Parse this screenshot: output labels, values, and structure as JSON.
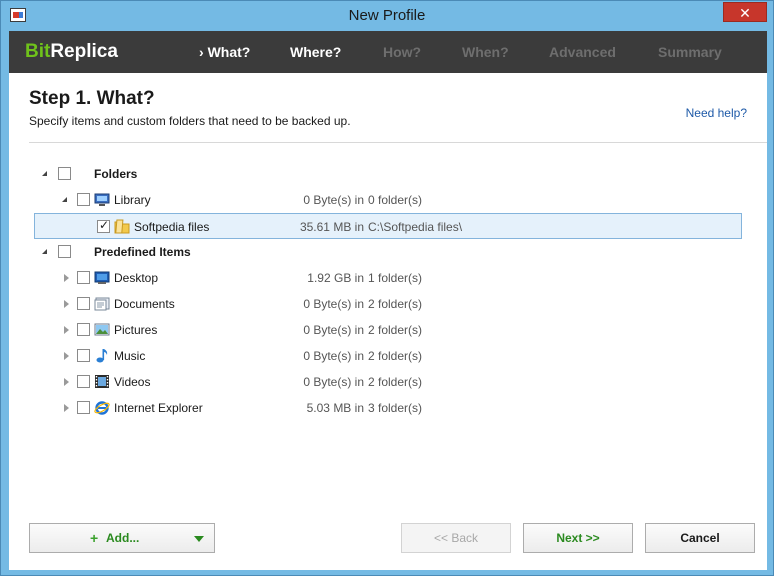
{
  "window": {
    "title": "New Profile",
    "close_glyph": "✕"
  },
  "brand": {
    "part1": "Bit",
    "part2": "Replica"
  },
  "steps": [
    {
      "label": "What?",
      "marker": "›",
      "state": "active"
    },
    {
      "label": "Where?",
      "state": "enabled"
    },
    {
      "label": "How?",
      "state": "disabled"
    },
    {
      "label": "When?",
      "state": "disabled"
    },
    {
      "label": "Advanced",
      "state": "disabled"
    },
    {
      "label": "Summary",
      "state": "disabled"
    }
  ],
  "page": {
    "title": "Step 1. What?",
    "subtitle": "Specify items and custom folders that need to be backed up.",
    "help": "Need help?"
  },
  "tree": {
    "folders": {
      "label": "Folders",
      "checked": false
    },
    "library": {
      "label": "Library",
      "size": "0 Byte(s) in",
      "detail": "0 folder(s)",
      "checked": false
    },
    "softpedia": {
      "label": "Softpedia files",
      "size": "35.61 MB in",
      "detail": "C:\\Softpedia files\\",
      "checked": true
    },
    "predefined": {
      "label": "Predefined Items",
      "checked": false
    },
    "items": [
      {
        "label": "Desktop",
        "size": "1.92 GB in",
        "detail": "1 folder(s)",
        "icon": "desktop-icon"
      },
      {
        "label": "Documents",
        "size": "0 Byte(s) in",
        "detail": "2 folder(s)",
        "icon": "documents-icon"
      },
      {
        "label": "Pictures",
        "size": "0 Byte(s) in",
        "detail": "2 folder(s)",
        "icon": "pictures-icon"
      },
      {
        "label": "Music",
        "size": "0 Byte(s) in",
        "detail": "2 folder(s)",
        "icon": "music-icon"
      },
      {
        "label": "Videos",
        "size": "0 Byte(s) in",
        "detail": "2 folder(s)",
        "icon": "videos-icon"
      },
      {
        "label": "Internet Explorer",
        "size": "5.03 MB in",
        "detail": "3 folder(s)",
        "icon": "internet-explorer-icon"
      }
    ]
  },
  "buttons": {
    "add": "Add...",
    "add_plus": "+",
    "back": "<< Back",
    "next": "Next >>",
    "cancel": "Cancel"
  },
  "colors": {
    "accent_green": "#6fc21b",
    "nav_bg": "#3b3b3b",
    "titlebar": "#74bae4",
    "close": "#c7362b",
    "link": "#1e5aa8",
    "selection": "#e5f1fb"
  }
}
